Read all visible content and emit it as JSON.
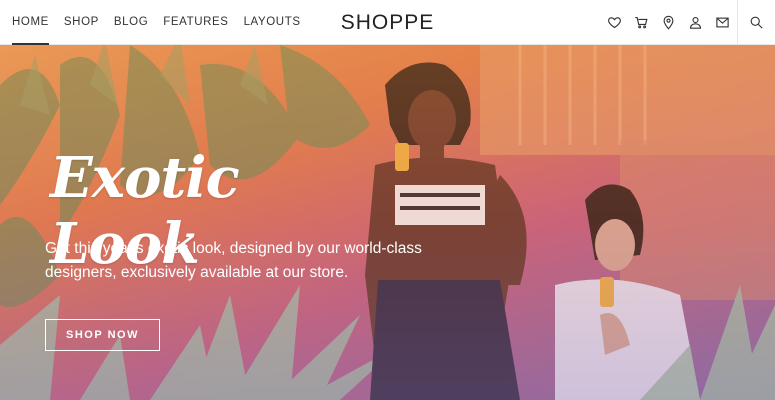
{
  "nav": {
    "links": [
      {
        "label": "HOME",
        "active": true
      },
      {
        "label": "SHOP",
        "active": false
      },
      {
        "label": "BLOG",
        "active": false
      },
      {
        "label": "FEATURES",
        "active": false
      },
      {
        "label": "LAYOUTS",
        "active": false
      }
    ],
    "brand": "SHOPPE",
    "icons": [
      "heart-icon",
      "cart-icon",
      "location-pin-icon",
      "user-icon",
      "mail-icon",
      "search-icon"
    ]
  },
  "hero": {
    "title": "Exotic Look",
    "subtitle": "Get this year's exotic look, designed by our world-class designers, exclusively available at our store.",
    "button_label": "SHOP NOW"
  },
  "colors": {
    "hero_orange": "#e07a4a",
    "hero_pink": "#c7617a",
    "hero_purple": "#8a6a9e",
    "text_dark": "#222222"
  }
}
